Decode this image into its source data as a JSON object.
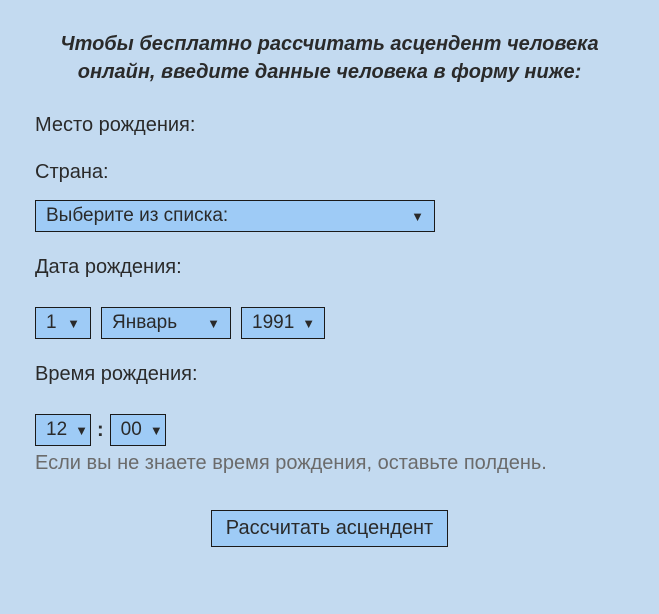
{
  "intro": "Чтобы бесплатно рассчитать асцендент человека онлайн, введите данные человека в форму ниже:",
  "birthplace": {
    "label": "Место рождения:"
  },
  "country": {
    "label": "Страна:",
    "selected": "Выберите из списка:"
  },
  "birthdate": {
    "label": "Дата рождения:",
    "day": "1",
    "month": "Январь",
    "year": "1991"
  },
  "birthtime": {
    "label": "Время рождения:",
    "hour": "12",
    "minute": "00",
    "separator": ":",
    "hint": "Если вы не знаете время рождения, оставьте полдень."
  },
  "submit": {
    "label": "Рассчитать асцендент"
  }
}
